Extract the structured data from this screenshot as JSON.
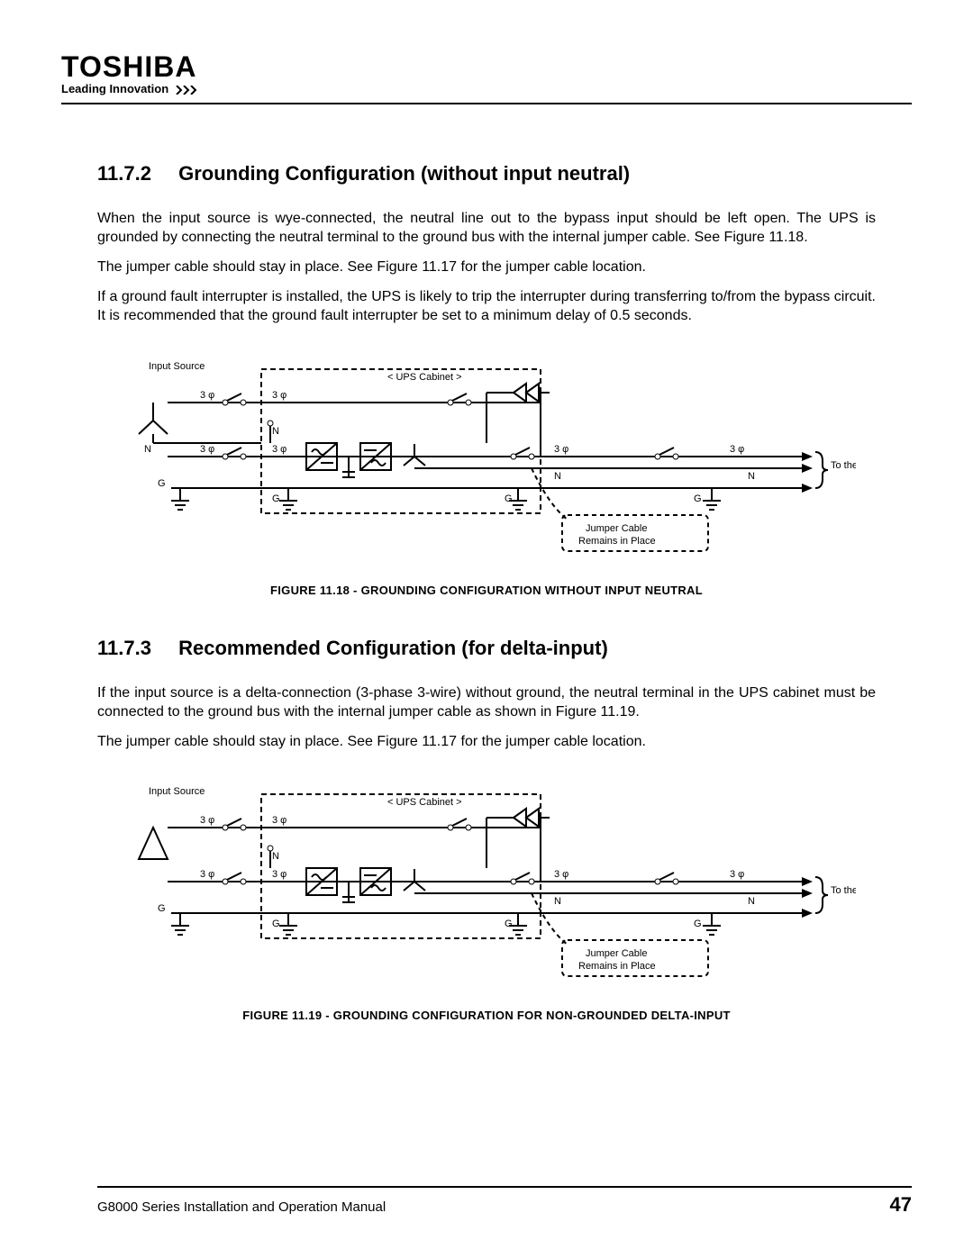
{
  "brand": {
    "name": "TOSHIBA",
    "tagline": "Leading Innovation"
  },
  "sections": {
    "s1172": {
      "num": "11.7.2",
      "title": "Grounding Configuration (without input neutral)",
      "p1": "When the input source is wye-connected, the neutral line out to the bypass input should be left open. The UPS is grounded by connecting the neutral terminal to the ground bus with the internal jumper cable. See Figure 11.18.",
      "p2": "The jumper cable should stay in place. See Figure 11.17 for the jumper cable location.",
      "p3": "If a ground fault interrupter is installed, the UPS is likely to trip the interrupter during transferring to/from the bypass circuit. It is recommended that the ground fault interrupter be set to a minimum delay of 0.5 seconds."
    },
    "s1173": {
      "num": "11.7.3",
      "title": "Recommended Configuration (for delta-input)",
      "p1": "If the input source is a delta-connection (3-phase 3-wire) without ground, the neutral terminal in the UPS cabinet must be connected to the ground bus with the internal jumper cable as shown in Figure 11.19.",
      "p2": "The jumper cable should stay in place. See Figure 11.17 for the jumper cable location."
    }
  },
  "figures": {
    "f1118": {
      "caption": "FIGURE 11.18 - GROUNDING CONFIGURATION WITHOUT INPUT NEUTRAL",
      "labels": {
        "input_source": "Input Source",
        "ups_cabinet": "< UPS Cabinet >",
        "three_phi": "3 φ",
        "N": "N",
        "G": "G",
        "to_load": "To the Load",
        "jumper1": "Jumper Cable",
        "jumper2": "Remains in Place"
      }
    },
    "f1119": {
      "caption": "FIGURE 11.19 - GROUNDING CONFIGURATION FOR NON-GROUNDED DELTA-INPUT",
      "labels": {
        "input_source": "Input Source",
        "ups_cabinet": "< UPS Cabinet >",
        "three_phi": "3 φ",
        "N": "N",
        "G": "G",
        "to_load": "To the Load",
        "jumper1": "Jumper Cable",
        "jumper2": "Remains in Place"
      }
    }
  },
  "footer": {
    "manual": "G8000 Series Installation and Operation Manual",
    "page": "47"
  }
}
